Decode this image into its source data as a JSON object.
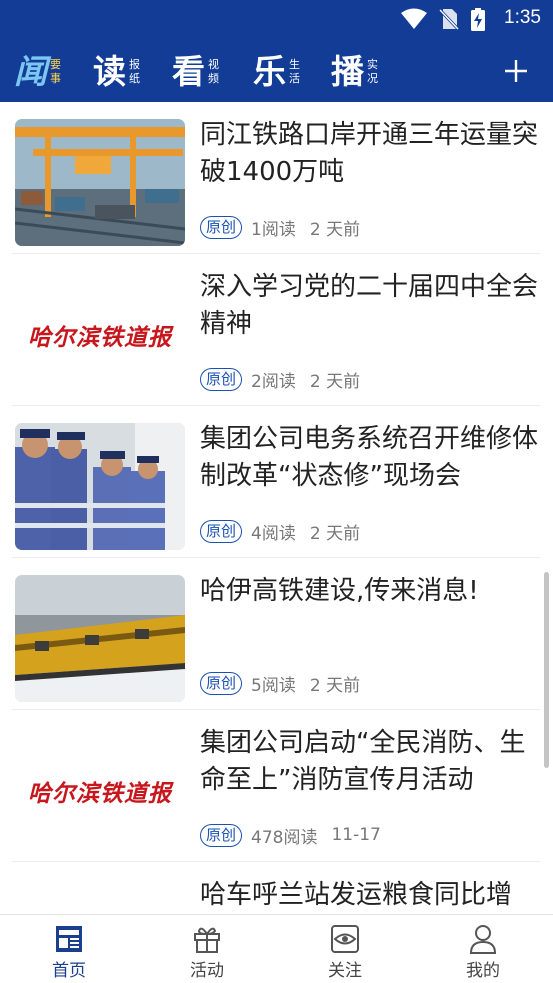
{
  "status_bar": {
    "time": "1:35"
  },
  "header": {
    "nav": [
      {
        "big": "闻",
        "small": [
          "要",
          "事"
        ]
      },
      {
        "big": "读",
        "small": [
          "报",
          "纸"
        ]
      },
      {
        "big": "看",
        "small": [
          "视",
          "频"
        ]
      },
      {
        "big": "乐",
        "small": [
          "生",
          "活"
        ]
      },
      {
        "big": "播",
        "small": [
          "实",
          "况"
        ]
      }
    ],
    "plus_icon": "plus-icon"
  },
  "news": [
    {
      "title": "同江铁路口岸开通三年运量突破1400万吨",
      "badge": "原创",
      "reads": "1阅读",
      "time": "2 天前",
      "thumb": "photo-crane"
    },
    {
      "title": "深入学习党的二十届四中全会精神",
      "badge": "原创",
      "reads": "2阅读",
      "time": "2 天前",
      "thumb": "logo",
      "logo_text": "哈尔滨铁道报"
    },
    {
      "title": "集团公司电务系统召开维修体制改革“状态修”现场会",
      "badge": "原创",
      "reads": "4阅读",
      "time": "2 天前",
      "thumb": "photo-workers"
    },
    {
      "title": "哈伊高铁建设,传来消息!",
      "badge": "原创",
      "reads": "5阅读",
      "time": "2 天前",
      "thumb": "photo-train"
    },
    {
      "title": "集团公司启动“全民消防、生命至上”消防宣传月活动",
      "badge": "原创",
      "reads": "478阅读",
      "time": "11-17",
      "thumb": "logo",
      "logo_text": "哈尔滨铁道报"
    },
    {
      "title": "哈车呼兰站发运粮食同比增",
      "badge": "",
      "reads": "",
      "time": "",
      "thumb": "none"
    }
  ],
  "tabs": [
    {
      "label": "首页",
      "icon": "news-icon"
    },
    {
      "label": "活动",
      "icon": "gift-icon"
    },
    {
      "label": "关注",
      "icon": "eye-icon"
    },
    {
      "label": "我的",
      "icon": "user-icon"
    }
  ],
  "colors": {
    "header_bg": "#123c96",
    "accent": "#1a52b3",
    "logo_red": "#c8161d"
  }
}
